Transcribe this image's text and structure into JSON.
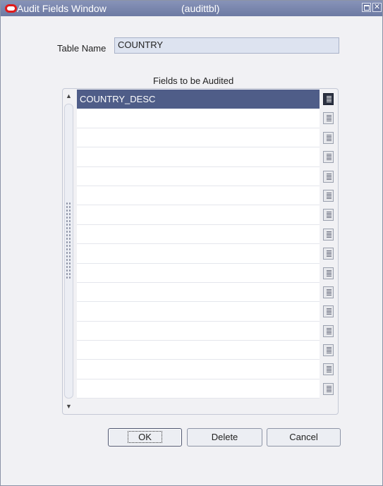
{
  "window": {
    "title": "Audit Fields Window",
    "subtitle": "(audittbl)",
    "icon": "oracle-logo-icon",
    "controls": [
      "maximize-icon",
      "close-icon"
    ]
  },
  "form": {
    "table_name_label": "Table Name",
    "table_name_value": "COUNTRY"
  },
  "grid": {
    "title": "Fields to be Audited",
    "rows": [
      "COUNTRY_DESC",
      "",
      "",
      "",
      "",
      "",
      "",
      "",
      "",
      "",
      "",
      "",
      "",
      "",
      "",
      "",
      ""
    ],
    "selected_row": 0
  },
  "buttons": {
    "ok": "OK",
    "delete": "Delete",
    "cancel": "Cancel"
  },
  "colors": {
    "titlebar": "#6d7aa3",
    "selected_row": "#4f5d88",
    "input_bg": "#dde3f0"
  }
}
